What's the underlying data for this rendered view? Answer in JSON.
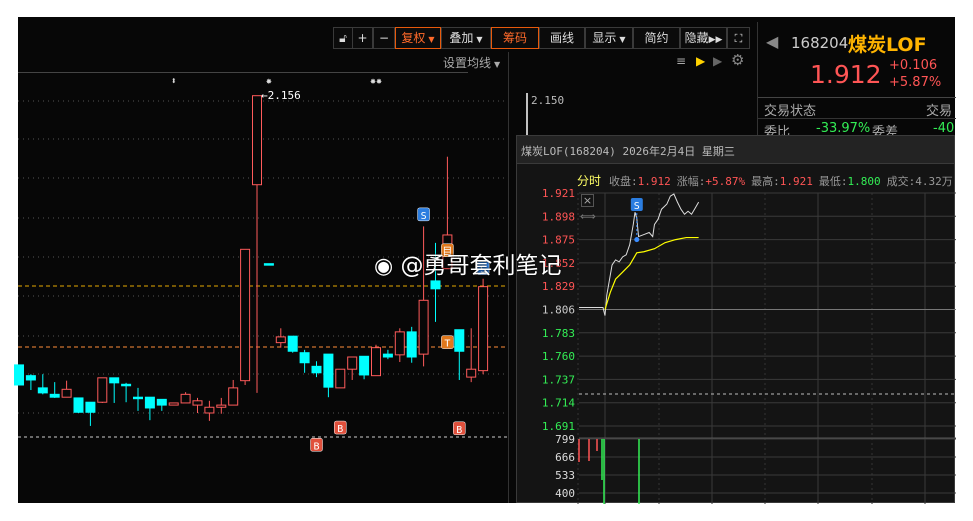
{
  "toolbar": {
    "fuquan": "复权",
    "diejia": "叠加",
    "chouma": "筹码",
    "huaxian": "画线",
    "xianshi": "显示",
    "jianyue": "简约",
    "yincang": "隐藏"
  },
  "ma_setting": "设置均线",
  "main_chart": {
    "axis_label": "2.150",
    "high_label": "2.156"
  },
  "quote": {
    "code": "168204",
    "name": "煤炭LOF",
    "price": "1.912",
    "change": "+0.106",
    "change_pct": "+5.87%",
    "status_label": "交易状态",
    "status_value": "交易",
    "wb_label": "委比",
    "wb_value": "-33.97%",
    "wc_label": "委差",
    "wc_value": "-40"
  },
  "popup": {
    "title": "煤炭LOF(168204) 2026年2月4日 星期三",
    "mode": "分时",
    "close_label": "收盘:",
    "close": "1.912",
    "chg_label": "涨幅:",
    "chg": "+5.87%",
    "high_label": "最高:",
    "high": "1.921",
    "low_label": "最低:",
    "low": "1.800",
    "vol_label": "成交:",
    "vol": "4.32万"
  },
  "watermark": "@勇哥套利笔记",
  "colors": {
    "up": "#ff5b5b",
    "down": "#00ffff",
    "accent": "#ff6a00",
    "name": "#ffb400",
    "green": "#33ee55"
  },
  "chart_data": [
    {
      "type": "candlestick",
      "ylabel": "price",
      "ylim": [
        1.681,
        2.16
      ],
      "reference_lines": {
        "prev_close": 1.806
      },
      "ohlc": [
        [
          1.781,
          1.781,
          1.753,
          1.753
        ],
        [
          1.766,
          1.768,
          1.746,
          1.76
        ],
        [
          1.749,
          1.768,
          1.74,
          1.742
        ],
        [
          1.74,
          1.757,
          1.735,
          1.736
        ],
        [
          1.736,
          1.759,
          1.736,
          1.747
        ],
        [
          1.735,
          1.735,
          1.714,
          1.715
        ],
        [
          1.729,
          1.729,
          1.696,
          1.715
        ],
        [
          1.729,
          1.763,
          1.728,
          1.763
        ],
        [
          1.763,
          1.763,
          1.728,
          1.756
        ],
        [
          1.754,
          1.756,
          1.729,
          1.753
        ],
        [
          1.736,
          1.749,
          1.717,
          1.735
        ],
        [
          1.736,
          1.736,
          1.704,
          1.721
        ],
        [
          1.733,
          1.733,
          1.717,
          1.725
        ],
        [
          1.725,
          1.728,
          1.725,
          1.728
        ],
        [
          1.728,
          1.743,
          1.728,
          1.74
        ],
        [
          1.725,
          1.735,
          1.714,
          1.731
        ],
        [
          1.714,
          1.731,
          1.703,
          1.722
        ],
        [
          1.722,
          1.735,
          1.713,
          1.725
        ],
        [
          1.725,
          1.76,
          1.725,
          1.749
        ],
        [
          1.759,
          1.942,
          1.753,
          1.942
        ],
        [
          2.032,
          2.156,
          1.742,
          2.156
        ],
        [
          1.922,
          1.922,
          1.922,
          1.922
        ],
        [
          1.812,
          1.832,
          1.805,
          1.82
        ],
        [
          1.821,
          1.821,
          1.798,
          1.8
        ],
        [
          1.798,
          1.802,
          1.77,
          1.784
        ],
        [
          1.779,
          1.786,
          1.764,
          1.77
        ],
        [
          1.796,
          1.796,
          1.736,
          1.75
        ],
        [
          1.749,
          1.775,
          1.749,
          1.775
        ],
        [
          1.775,
          1.792,
          1.76,
          1.792
        ],
        [
          1.793,
          1.793,
          1.761,
          1.767
        ],
        [
          1.766,
          1.809,
          1.766,
          1.805
        ],
        [
          1.796,
          1.802,
          1.789,
          1.792
        ],
        [
          1.795,
          1.832,
          1.785,
          1.827
        ],
        [
          1.827,
          1.834,
          1.784,
          1.792
        ],
        [
          1.796,
          1.974,
          1.779,
          1.871
        ],
        [
          1.898,
          1.951,
          1.841,
          1.887
        ],
        [
          1.915,
          2.071,
          1.915,
          1.962
        ],
        [
          1.83,
          1.83,
          1.76,
          1.8
        ],
        [
          1.764,
          1.832,
          1.757,
          1.775
        ],
        [
          1.773,
          1.901,
          1.768,
          1.89
        ]
      ],
      "markers": [
        {
          "index": 34,
          "label": "S",
          "price": 1.99
        },
        {
          "index": 39,
          "label": "S",
          "price": 1.915
        },
        {
          "index": 36,
          "label": "目",
          "price": 1.94
        },
        {
          "index": 36,
          "label": "T",
          "price": 1.812
        },
        {
          "index": 25,
          "label": "B",
          "price": 1.669
        },
        {
          "index": 27,
          "label": "B",
          "price": 1.693
        },
        {
          "index": 37,
          "label": "B",
          "price": 1.692
        }
      ],
      "flags": [
        {
          "index": 13,
          "label": "⬍"
        },
        {
          "index": 21,
          "label": "✸"
        },
        {
          "index": 30,
          "label": "✸✸"
        }
      ]
    },
    {
      "type": "line",
      "title": "分时",
      "ylim": [
        1.691,
        1.921
      ],
      "yticks": [
        "1.921",
        "1.898",
        "1.875",
        "1.852",
        "1.829",
        "1.806",
        "1.783",
        "1.760",
        "1.737",
        "1.714",
        "1.691"
      ],
      "price": [
        [
          0,
          1.8
        ],
        [
          1,
          1.82
        ],
        [
          2,
          1.83
        ],
        [
          4,
          1.85
        ],
        [
          6,
          1.855
        ],
        [
          8,
          1.853
        ],
        [
          10,
          1.858
        ],
        [
          12,
          1.86
        ],
        [
          14,
          1.87
        ],
        [
          16,
          1.89
        ],
        [
          17,
          1.902
        ],
        [
          18,
          1.896
        ],
        [
          19,
          1.878
        ],
        [
          22,
          1.88
        ],
        [
          25,
          1.882
        ],
        [
          27,
          1.878
        ],
        [
          28,
          1.89
        ],
        [
          30,
          1.895
        ],
        [
          32,
          1.905
        ],
        [
          35,
          1.91
        ],
        [
          37,
          1.918
        ],
        [
          39,
          1.92
        ],
        [
          41,
          1.912
        ],
        [
          43,
          1.905
        ],
        [
          45,
          1.9
        ],
        [
          47,
          1.903
        ],
        [
          49,
          1.9
        ],
        [
          51,
          1.906
        ],
        [
          53,
          1.912
        ]
      ],
      "avg": [
        [
          0,
          1.806
        ],
        [
          3,
          1.823
        ],
        [
          6,
          1.836
        ],
        [
          10,
          1.843
        ],
        [
          14,
          1.85
        ],
        [
          18,
          1.862
        ],
        [
          22,
          1.863
        ],
        [
          28,
          1.866
        ],
        [
          34,
          1.872
        ],
        [
          40,
          1.875
        ],
        [
          46,
          1.877
        ],
        [
          53,
          1.877
        ]
      ],
      "marker": {
        "minute": 18,
        "label": "S"
      },
      "volume_ticks": [
        "799",
        "666",
        "533",
        "400"
      ]
    }
  ]
}
